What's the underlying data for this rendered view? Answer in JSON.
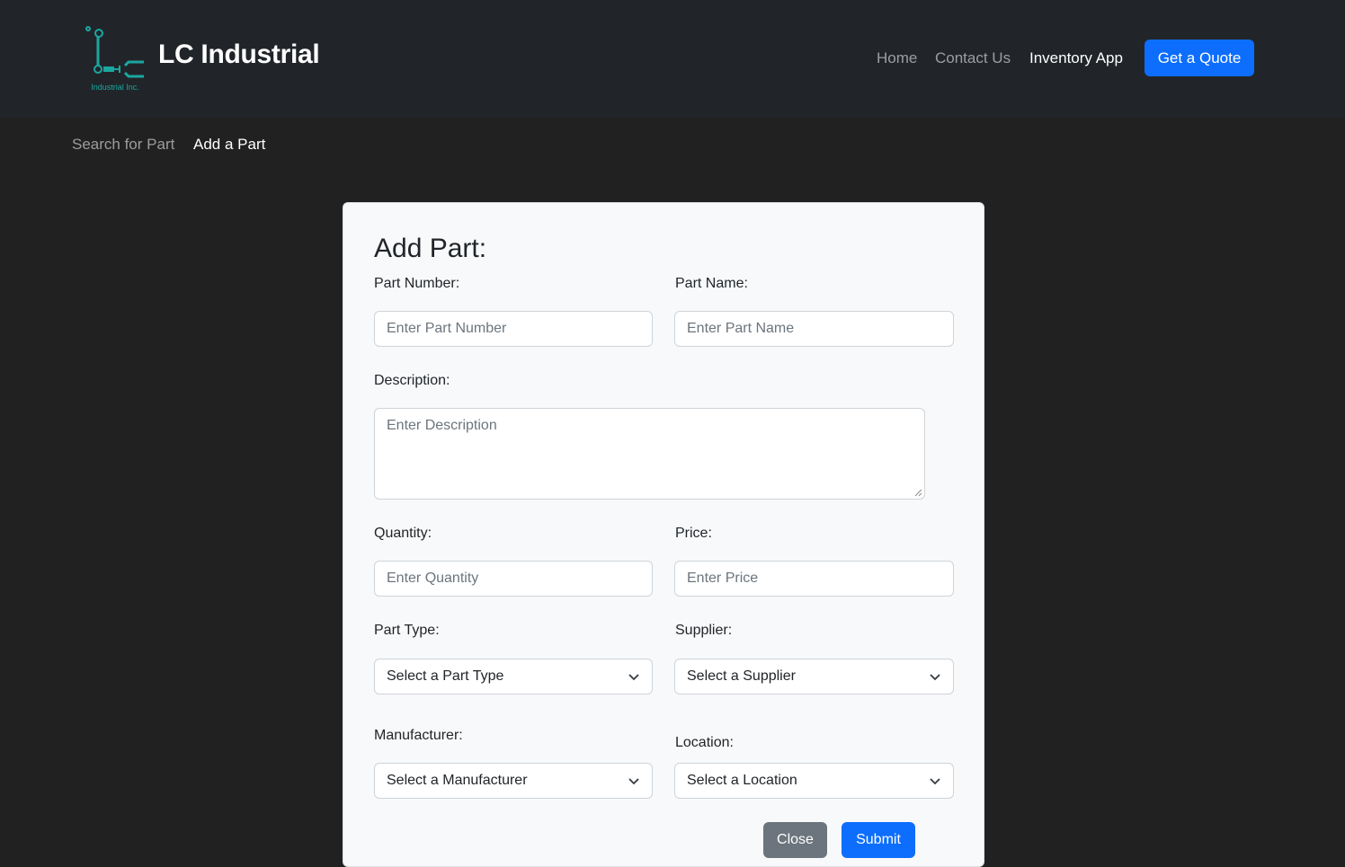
{
  "header": {
    "logo_caption": "Industrial Inc.",
    "brand": "LC Industrial",
    "nav": [
      {
        "label": "Home"
      },
      {
        "label": "Contact Us"
      },
      {
        "label": "Inventory App"
      }
    ],
    "cta_label": "Get a Quote",
    "accent_color": "#0d6efd",
    "logo_color": "#1aa7a0"
  },
  "breadcrumb": [
    {
      "label": "Search for Part"
    },
    {
      "label": "Add a Part"
    }
  ],
  "form": {
    "title": "Add Part:",
    "part_number": {
      "label": "Part Number:",
      "placeholder": "Enter Part Number"
    },
    "part_name": {
      "label": "Part Name:",
      "placeholder": "Enter Part Name"
    },
    "description": {
      "label": "Description:",
      "placeholder": "Enter Description"
    },
    "quantity": {
      "label": "Quantity:",
      "placeholder": "Enter Quantity"
    },
    "price": {
      "label": "Price:",
      "placeholder": "Enter Price"
    },
    "part_type": {
      "label": "Part Type:",
      "selected": "Select a Part Type"
    },
    "supplier": {
      "label": "Supplier:",
      "selected": "Select a Supplier"
    },
    "manufacturer": {
      "label": "Manufacturer:",
      "selected": "Select a Manufacturer"
    },
    "location": {
      "label": "Location:",
      "selected": "Select a Location"
    },
    "close_label": "Close",
    "submit_label": "Submit"
  }
}
